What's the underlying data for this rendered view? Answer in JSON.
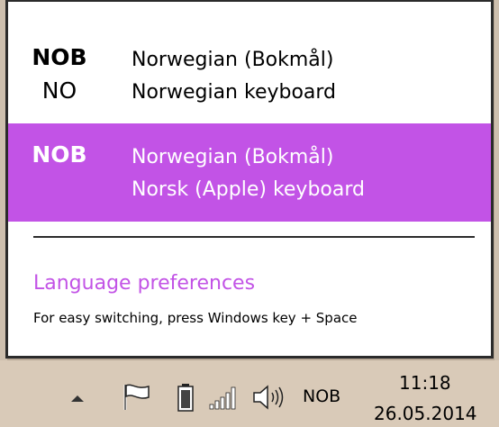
{
  "flyout": {
    "items": [
      {
        "code": "NOB",
        "subcode": "NO",
        "language": "Norwegian (Bokmål)",
        "keyboard": "Norwegian keyboard",
        "selected": false
      },
      {
        "code": "NOB",
        "language": "Norwegian (Bokmål)",
        "keyboard": "Norsk (Apple) keyboard",
        "selected": true
      }
    ],
    "preferences_link": "Language preferences",
    "hint": "For easy switching, press Windows key + Space"
  },
  "taskbar": {
    "icons": [
      "show-hidden-icons-arrow",
      "action-center-flag-icon",
      "battery-icon",
      "network-signal-icon",
      "volume-icon"
    ],
    "language_indicator": "NOB",
    "time": "11:18",
    "date": "26.05.2014"
  },
  "colors": {
    "accent": "#c253e6",
    "taskbar": "#d9cab8",
    "flyout_border": "#2b2b2b"
  }
}
